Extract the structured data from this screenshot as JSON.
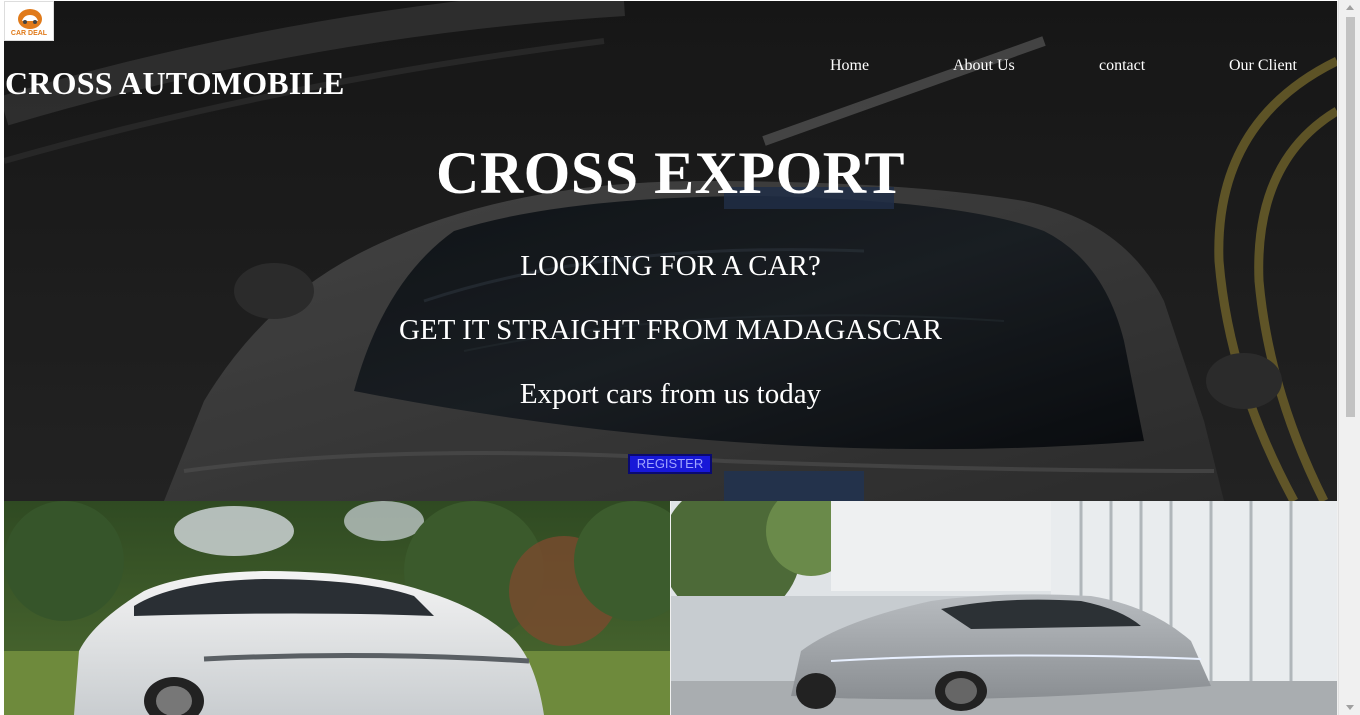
{
  "logo": {
    "text": "CAR DEAL",
    "icon": "car-deal-logo-icon"
  },
  "brand": {
    "title": "CROSS AUTOMOBILE"
  },
  "nav": {
    "items": [
      {
        "label": "Home"
      },
      {
        "label": "About Us"
      },
      {
        "label": "contact"
      },
      {
        "label": "Our Client"
      }
    ]
  },
  "hero": {
    "title": "CROSS EXPORT",
    "line1": "LOOKING FOR A CAR?",
    "line2": "GET IT STRAIGHT FROM MADAGASCAR",
    "line3": "Export cars from us today",
    "register_label": "REGISTER"
  },
  "gallery": {
    "left_image": "white-electric-sedan-image",
    "right_image": "silver-electric-sedan-image"
  },
  "colors": {
    "register_bg": "#1818d8",
    "text": "#ffffff",
    "logo_accent": "#e07a1a"
  }
}
